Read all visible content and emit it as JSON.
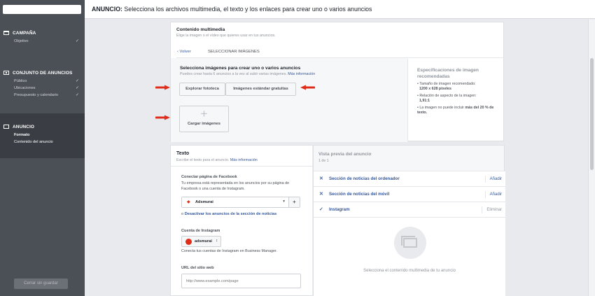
{
  "header": {
    "bold": "ANUNCIO:",
    "text": " Selecciona los archivos multimedia, el texto y los enlaces para crear uno o varios anuncios"
  },
  "sidebar": {
    "campaign": {
      "title": "CAMPAÑA",
      "items": [
        "Objetivo"
      ]
    },
    "adset": {
      "title": "CONJUNTO DE ANUNCIOS",
      "items": [
        "Público",
        "Ubicaciones",
        "Presupuesto y calendario"
      ]
    },
    "ad": {
      "title": "ANUNCIO",
      "items": [
        "Formato",
        "Contenido del anuncio"
      ]
    },
    "close_label": "Cerrar sin guardar"
  },
  "media": {
    "title": "Contenido multimedia",
    "subtitle": "Elige la imagen o el vídeo que quieres usar en tus anuncios.",
    "back": "Volver",
    "select_images": "SELECCIONAR IMÁGENES",
    "heading": "Selecciona imágenes para crear uno o varios anuncios",
    "hint": "Puedes crear hasta 6 anuncios a la vez al subir varias imágenes.",
    "more_info": "Más información",
    "browse_label": "Explorar fototeca",
    "stock_label": "Imágenes estándar gratuitas",
    "upload_label": "Cargar imágenes",
    "specs": {
      "title": "Especificaciones de imagen recomendadas",
      "size_label": "Tamaño de imagen recomendado:",
      "size_value": "1200 x 628 píxeles",
      "ratio_label": "Relación de aspecto de la imagen:",
      "ratio_value": "1,91:1",
      "text_note": "La imagen no puede incluir",
      "text_bold": "más del 20 % de texto."
    }
  },
  "text": {
    "title": "Texto",
    "subtitle": "Escribe el texto para el anuncio.",
    "more_info": "Más información",
    "fb_title": "Conectar página de Facebook",
    "fb_desc": "Tu empresa está representada en los anuncios por su página de Facebook o una cuenta de Instagram.",
    "fb_page": "Adsmurai",
    "disable_prefix": "o",
    "disable_link": "Desactivar los anuncios de la sección de noticias",
    "ig_title": "Cuenta de Instagram",
    "ig_account": "adsmurai",
    "ig_desc": "Conecta tus cuentas de Instagram en Business Manager.",
    "url_title": "URL del sitio web",
    "url_placeholder": "http://www.example.com/page"
  },
  "preview": {
    "title": "Vista previa del anuncio",
    "count": "1 de 1",
    "rows": [
      {
        "label": "Sección de noticias del ordenador",
        "action": "Añadir"
      },
      {
        "label": "Sección de noticias del móvil",
        "action": "Añadir"
      },
      {
        "label": "Instagram",
        "action": "Eliminar"
      }
    ],
    "empty": "Selecciona el contenido multimedia de tu anuncio"
  },
  "colors": {
    "accent": "#4267b2",
    "arrow": "#e02d1a",
    "sidebar": "#4b4f56"
  }
}
